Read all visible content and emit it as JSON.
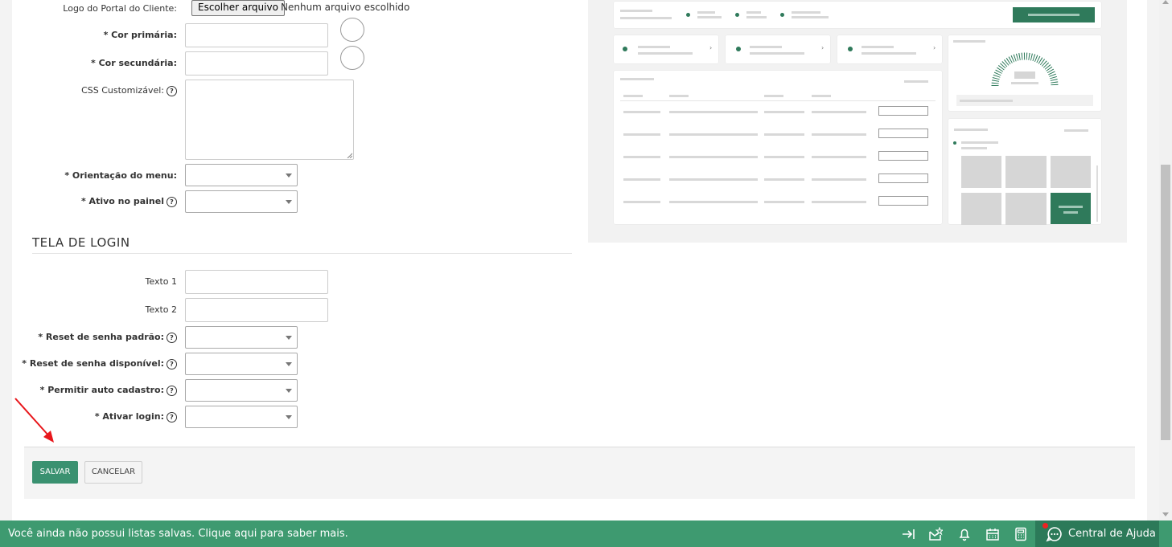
{
  "form": {
    "logo_label": "Logo do Portal do Cliente:",
    "file_button": "Escolher arquivo",
    "file_status": "Nenhum arquivo escolhido",
    "primary_color_label": "* Cor primária:",
    "secondary_color_label": "* Cor secundária:",
    "css_label": "CSS Customizável:",
    "menu_orientation_label": "* Orientação do menu:",
    "active_panel_label": "* Ativo no painel"
  },
  "login_section": {
    "title": "TELA DE LOGIN",
    "text1_label": "Texto 1",
    "text2_label": "Texto 2",
    "reset_default_label": "* Reset de senha padrão:",
    "reset_available_label": "* Reset de senha disponível:",
    "auto_register_label": "* Permitir auto cadastro:",
    "activate_login_label": "* Ativar login:"
  },
  "actions": {
    "save": "SALVAR",
    "cancel": "CANCELAR"
  },
  "bottom_bar": {
    "message": "Você ainda não possui listas salvas. Clique aqui para saber mais.",
    "help_center": "Central de Ajuda",
    "icons": [
      "collapse-arrow-icon",
      "mail-star-icon",
      "bell-icon",
      "calendar-icon",
      "calculator-icon",
      "chat-icon"
    ]
  },
  "colors": {
    "accent": "#3e9a70",
    "accent_dark": "#2c7a59",
    "save_button": "#3a9170",
    "notification_dot": "#e22222",
    "annotation_arrow": "#e8161b"
  }
}
